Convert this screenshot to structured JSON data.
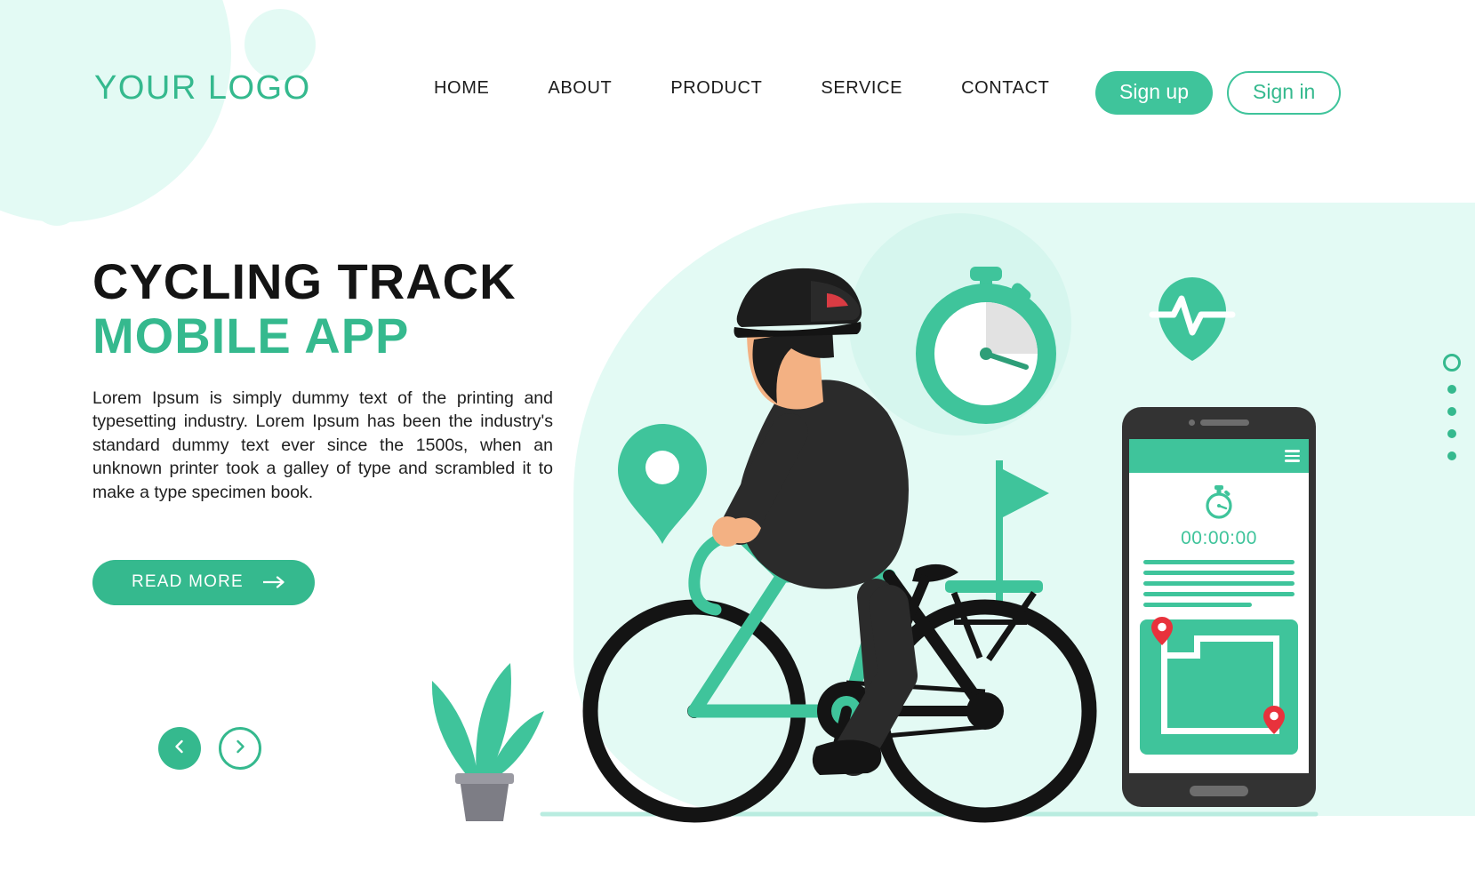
{
  "brand": {
    "logo_text": "YOUR LOGO",
    "accent_color": "#35b98e",
    "accent_light": "#3fc49b",
    "bg_tint": "#e3faf4",
    "dark": "#141414"
  },
  "nav": {
    "items": [
      {
        "label": "HOME"
      },
      {
        "label": "ABOUT"
      },
      {
        "label": "PRODUCT"
      },
      {
        "label": "SERVICE"
      },
      {
        "label": "CONTACT"
      }
    ]
  },
  "auth": {
    "signup_label": "Sign up",
    "signin_label": "Sign in"
  },
  "hero": {
    "title_line1": "CYCLING TRACK",
    "title_line2": "MOBILE APP",
    "paragraph": "Lorem Ipsum is simply dummy text of the printing and typesetting industry. Lorem Ipsum has been the industry's standard dummy text ever since the 1500s, when an unknown printer took a galley of type and scrambled it to make a type specimen book.",
    "cta_label": "READ MORE",
    "cta_icon": "arrow-right-icon"
  },
  "carousel": {
    "prev_icon": "arrow-left-icon",
    "next_icon": "arrow-right-icon"
  },
  "pagination": {
    "dots": [
      {
        "state": "active"
      },
      {
        "state": "inactive"
      },
      {
        "state": "inactive"
      },
      {
        "state": "inactive"
      },
      {
        "state": "inactive"
      }
    ]
  },
  "illustration": {
    "icons": [
      {
        "name": "stopwatch-icon"
      },
      {
        "name": "heart-pulse-icon"
      },
      {
        "name": "map-pin-icon"
      },
      {
        "name": "finish-flag-icon"
      },
      {
        "name": "cyclist-illustration"
      },
      {
        "name": "plant-pot-illustration"
      }
    ]
  },
  "phone": {
    "menu_icon": "hamburger-menu-icon",
    "timer_icon": "stopwatch-icon",
    "timer_value": "00:00:00",
    "text_lines": 5,
    "map": {
      "pins": [
        {
          "name": "start-pin",
          "color": "#e8323c"
        },
        {
          "name": "end-pin",
          "color": "#e8323c"
        }
      ]
    }
  }
}
